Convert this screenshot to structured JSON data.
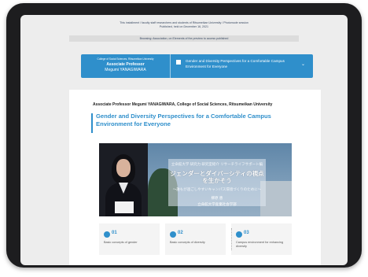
{
  "page": {
    "top_note_line1": "This installment / faculty staff researchers and students of Ritsumeikan University / Photomode session",
    "top_note_line2": "Published, held on December 16, 2021",
    "info_bar": "Browsing: Association, on Elements of the preview to access published"
  },
  "banner": {
    "college": "College of Social Sciences, Ritsumeikan University",
    "position": "Associate Professor",
    "person": "Megumi YANAGIWARA",
    "title": "Gender and Diversity Perspectives for a Comfortable Campus Environment for Everyone",
    "expand_icon": "chevron-down-icon"
  },
  "article": {
    "author": "Associate Professor Megumi YANAGIWARA, College of Social Sciences, Ritsumeikan University",
    "heading": "Gender and Diversity Perspectives for a Comfortable Campus Environment for Everyone"
  },
  "video": {
    "series": "立命館大学 研究力 研究室紹介 リサーチライフサポート編",
    "title_jp": "ジェンダーとダイバーシティの視点を生かそう",
    "subtitle_jp": "〜誰もが過ごしやすいキャンパス環境づくりのために〜",
    "speaker_jp": "柳原 恵",
    "affiliation_jp": "立命館大学産業社会学部"
  },
  "stats": [
    {
      "num": "01",
      "label": "Basic concepts of gender",
      "icon": "bulb-icon"
    },
    {
      "num": "02",
      "label": "Basic concepts of diversity",
      "icon": "bulb-icon"
    },
    {
      "num": "03",
      "label": "Campus environment for enhancing diversity",
      "icon": "bulb-icon"
    }
  ],
  "colors": {
    "accent": "#2f8fcb",
    "device": "#1d1d1f"
  }
}
